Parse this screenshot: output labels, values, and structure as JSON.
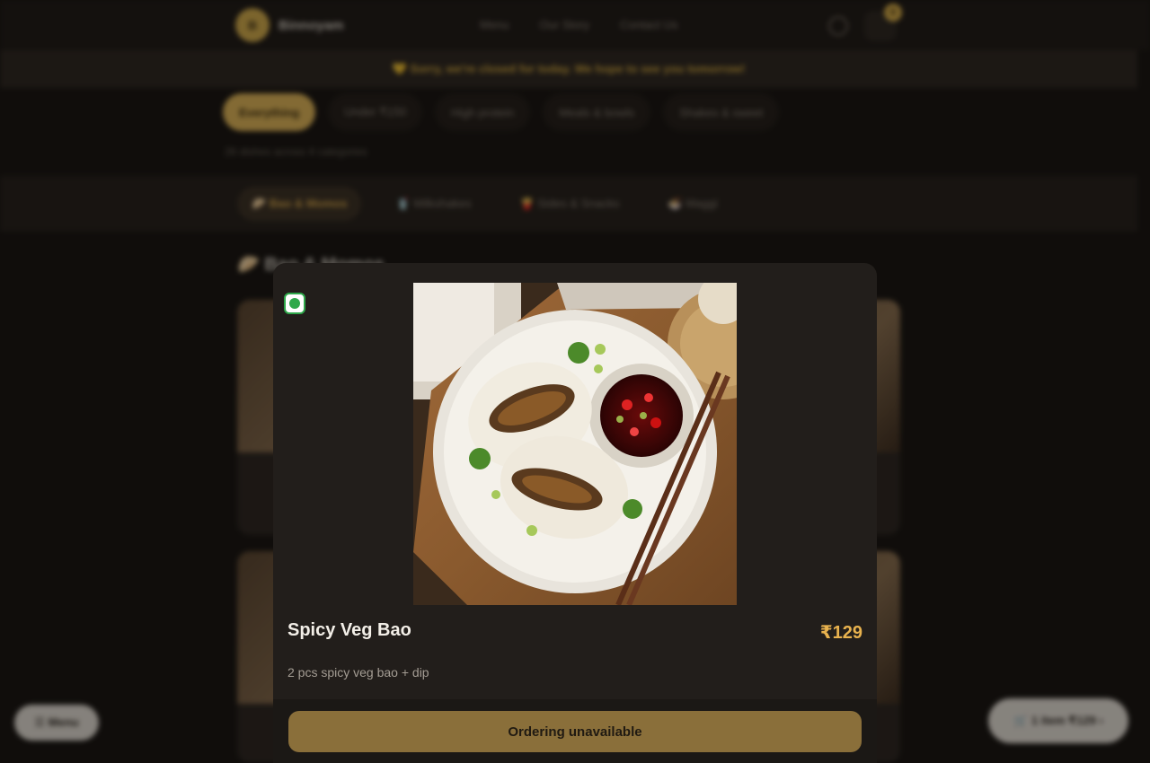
{
  "header": {
    "brand_initial": "B",
    "brand_name": "Binnoyam",
    "nav": [
      "Menu",
      "Our Story",
      "Contact Us"
    ],
    "cart_count": "0"
  },
  "banner": {
    "text": "💛 Sorry, we're closed for today. We hope to see you tomorrow!"
  },
  "filters": {
    "chips": [
      "Everything",
      "Under ₹150",
      "High protein",
      "Meals & bowls",
      "Shakes & sweet"
    ],
    "active": "Everything",
    "count_text": "26 dishes across 4 categories"
  },
  "categories": {
    "tabs": [
      "🥟 Bao & Momos",
      "🥤 Milkshakes",
      "🍟 Sides & Snacks",
      "🍜 Maggi"
    ],
    "active": "🥟 Bao & Momos"
  },
  "section": {
    "title": "🥟 Bao & Momos"
  },
  "fab": {
    "menu_label": "☰ Menu",
    "cart_label": "🛒 1 item ₹129 ›"
  },
  "modal": {
    "item_name": "Spicy Veg Bao",
    "price": "₹129",
    "description": "2 pcs spicy veg bao + dip",
    "order_button": "Ordering unavailable",
    "veg": true
  },
  "colors": {
    "accent": "#e8b24e",
    "veg_green": "#2ea84a",
    "button_disabled": "#8a6f3a",
    "modal_bg": "#221e1b"
  },
  "icons": {
    "veg": "veg-indicator-icon",
    "search": "search-icon",
    "cart": "cart-icon"
  }
}
